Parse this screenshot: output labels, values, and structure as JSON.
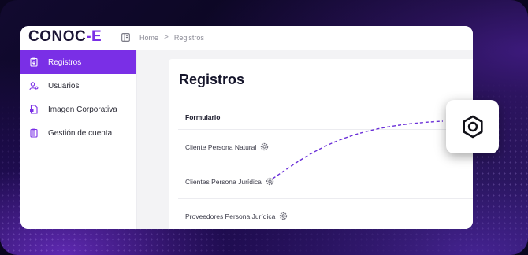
{
  "app": {
    "logo_main": "CONOC",
    "logo_accent": "-E",
    "accent_color": "#7a2fe6"
  },
  "breadcrumb": {
    "home": "Home",
    "separator": ">",
    "current": "Registros"
  },
  "sidebar": {
    "items": [
      {
        "label": "Registros",
        "icon": "clipboard-icon",
        "active": true
      },
      {
        "label": "Usuarios",
        "icon": "user-settings-icon",
        "active": false
      },
      {
        "label": "Imagen Corporativa",
        "icon": "document-icon",
        "active": false
      },
      {
        "label": "Gestión de cuenta",
        "icon": "clipboard-list-icon",
        "active": false
      }
    ]
  },
  "main": {
    "title": "Registros",
    "table_header": "Formulario",
    "rows": [
      {
        "label": "Cliente Persona Natural",
        "icon": "gear-icon"
      },
      {
        "label": "Clientes Persona Jurídica",
        "icon": "gear-icon"
      },
      {
        "label": "Proveedores Persona Jurídica",
        "icon": "gear-icon"
      }
    ]
  },
  "callout": {
    "icon": "hex-nut-icon"
  }
}
